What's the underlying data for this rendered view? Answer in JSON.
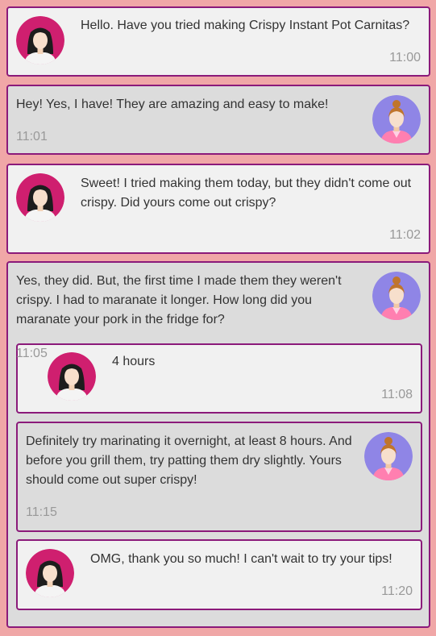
{
  "colors": {
    "page_background": "#f0a7a7",
    "card_border": "#8b1a7a",
    "card_light": "#f1f1f1",
    "card_dark": "#dcdcdc",
    "time_text": "#999999",
    "avatar_dark_hair_bg": "#cf1f6f",
    "avatar_bun_bg": "#8f85e6"
  },
  "icons": {
    "dark_hair": "woman-dark-hair-avatar",
    "bun": "woman-bun-hair-avatar"
  },
  "messages": [
    {
      "text": "Hello. Have you tried making Crispy Instant Pot Carnitas?",
      "time": "11:00"
    },
    {
      "text": "Hey! Yes, I have! They are amazing and easy to make!",
      "time": "11:01"
    },
    {
      "text": "Sweet! I tried making them today, but they didn't come out crispy. Did yours come out crispy?",
      "time": "11:02"
    },
    {
      "text": "Yes, they did. But, the first time I made them they weren't crispy. I had to maranate it longer. How long did you maranate your pork in the fridge for?",
      "time": "11:05"
    },
    {
      "text": "4 hours",
      "time": "11:08"
    },
    {
      "text": "Definitely try marinating it overnight, at least 8 hours. And before you grill them, try patting them dry slightly. Yours should come out super crispy!",
      "time": "11:15"
    },
    {
      "text": "OMG, thank you so much! I can't wait to try your tips!",
      "time": "11:20"
    }
  ]
}
